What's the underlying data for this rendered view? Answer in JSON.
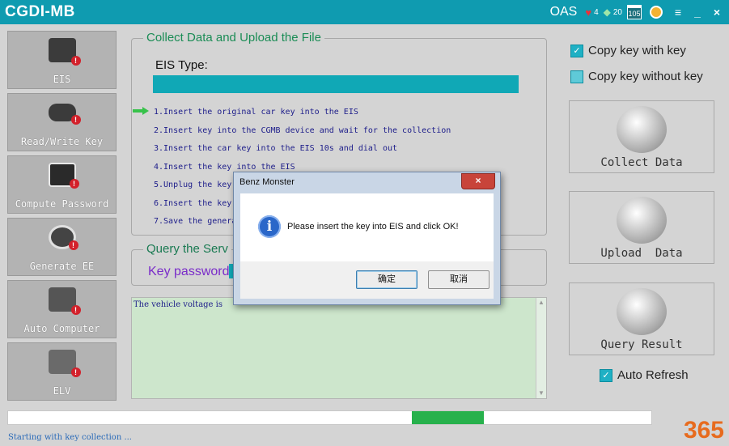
{
  "app": {
    "title": "CGDI-MB"
  },
  "titlebar": {
    "oas": "OAS",
    "hearts": "4",
    "gems": "20",
    "calendar": "105",
    "menu_icon": "≡",
    "minimize": "_",
    "close": "×"
  },
  "sidebar": {
    "items": [
      {
        "label": "EIS",
        "icon": "eis-module-icon"
      },
      {
        "label": "Read/Write Key",
        "icon": "car-key-icon"
      },
      {
        "label": "Compute Password",
        "icon": "computer-icon"
      },
      {
        "label": "Generate EE",
        "icon": "printer-icon"
      },
      {
        "label": "Auto Computer",
        "icon": "ecu-icon"
      },
      {
        "label": "ELV",
        "icon": "elv-module-icon"
      }
    ],
    "badge": "!"
  },
  "collect": {
    "title": "Collect Data and Upload the File",
    "eis_type_label": "EIS Type:",
    "steps": [
      "1.Insert the original car key into the EIS",
      "2.Insert key into the CGMB device and wait for the collection",
      "3.Insert the car key into the EIS 10s and dial out",
      "4.Insert the key into the EIS",
      "5.Unplug the key",
      "6.Insert the key",
      "7.Save the genera"
    ]
  },
  "query": {
    "title": "Query the Serv",
    "key_password_label": "Key password"
  },
  "log": {
    "text": "The vehicle voltage is"
  },
  "options": {
    "copy_with_key": "Copy key with key",
    "copy_without_key": "Copy key without key",
    "auto_refresh": "Auto Refresh"
  },
  "actions": {
    "collect": "Collect Data",
    "upload": "Upload  Data",
    "query": "Query Result"
  },
  "progress": {
    "start": 0.628,
    "end": 0.74,
    "color": "#27b14c"
  },
  "status": "Starting with key collection ...",
  "logo": {
    "text": "365"
  },
  "dialog": {
    "title": "Benz Monster",
    "message": "Please insert the key into EIS and click OK!",
    "ok": "确定",
    "cancel": "取消",
    "close": "×"
  },
  "colors": {
    "accent": "#0f9bb0",
    "bar": "#10a8b6",
    "green_title": "#1a8c55"
  }
}
